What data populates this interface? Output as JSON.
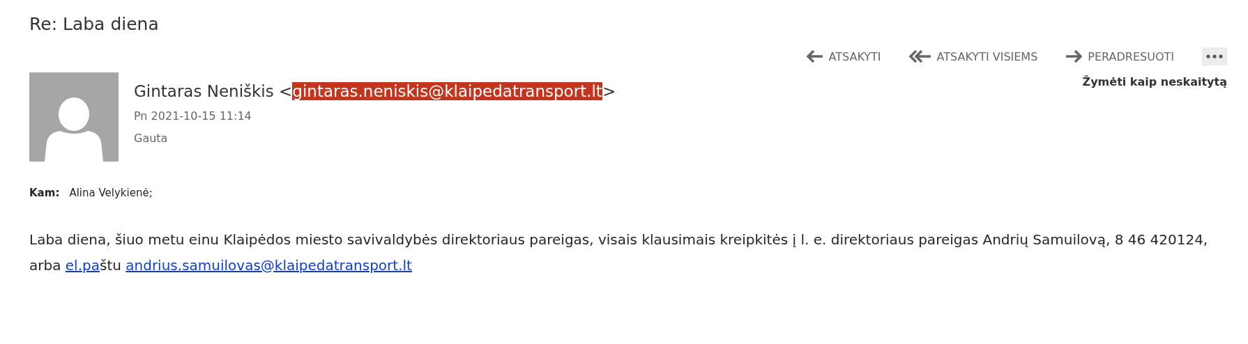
{
  "title": "Re: Laba diena",
  "actions": [
    {
      "kind": "reply",
      "label": "ATSAKYTI"
    },
    {
      "kind": "reply-all",
      "label": "ATSAKYTI VISIEMS"
    },
    {
      "kind": "forward",
      "label": "PERADRESUOTI"
    },
    {
      "kind": "more"
    }
  ],
  "sender": {
    "name": "Gintaras Neniškis",
    "open": "<",
    "email": "gintaras.neniskis@klaipedatransport.lt",
    "close": ">",
    "highlighted": true
  },
  "date": "Pn 2021-10-15 11:14",
  "folder": "Gauta",
  "mark_unread": "Žymėti kaip neskaitytą",
  "to": {
    "label": "Kam:",
    "value": "Alina Velykienė;"
  },
  "body": [
    {
      "kind": "text",
      "text": "Laba diena, šiuo metu einu Klaipėdos miesto savivaldybės direktoriaus pareigas, visais klausimais kreipkitės į l. e. direktoriaus pareigas Andrių Samuilovą, 8 46 420124, arba "
    },
    {
      "kind": "link",
      "text": "el.pa"
    },
    {
      "kind": "text",
      "text": "štu "
    },
    {
      "kind": "link",
      "text": "andrius.samuilovas@klaipedatransport.lt"
    }
  ]
}
